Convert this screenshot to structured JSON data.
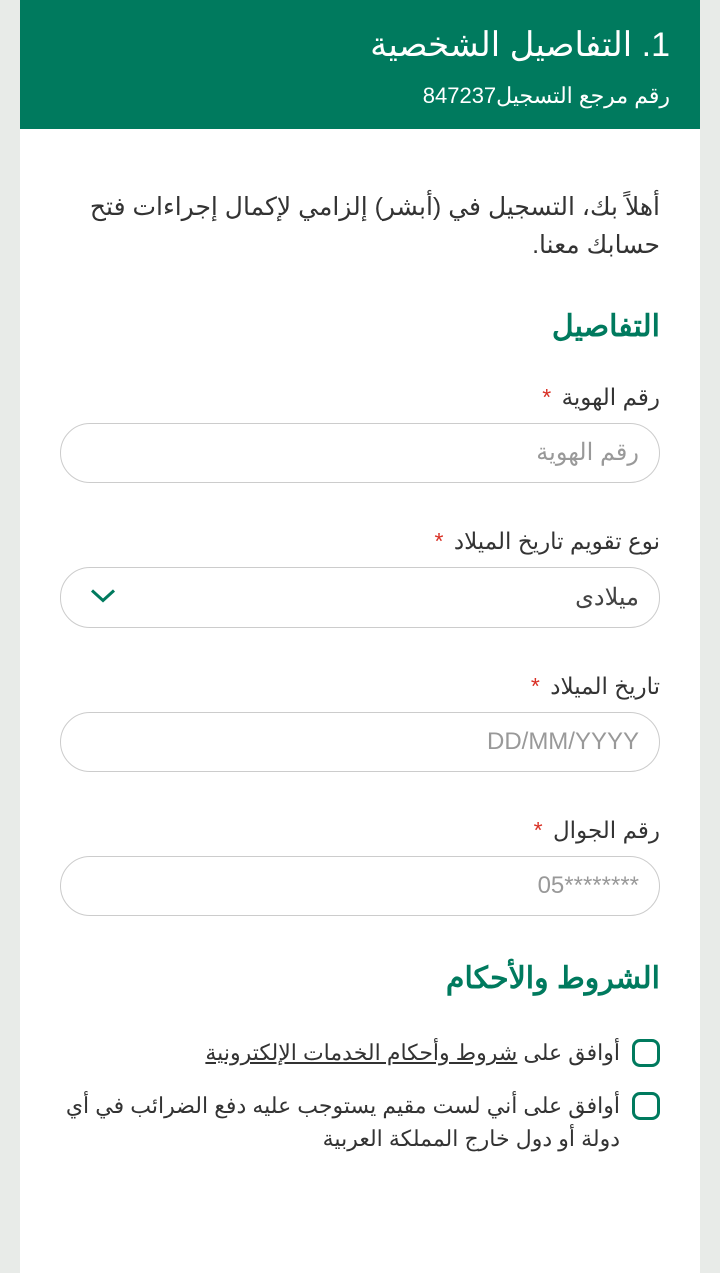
{
  "header": {
    "title": "1. التفاصيل الشخصية",
    "subtitle": "رقم مرجع التسجيل847237"
  },
  "intro": "أهلاً بك، التسجيل في (أبشر) إلزامي لإكمال إجراءات فتح حسابك معنا.",
  "details": {
    "section_title": "التفاصيل",
    "id_label": "رقم الهوية",
    "id_placeholder": "رقم الهوية",
    "calendar_label": "نوع تقويم تاريخ الميلاد",
    "calendar_value": "ميلادى",
    "dob_label": "تاريخ الميلاد",
    "dob_placeholder": "DD/MM/YYYY",
    "mobile_label": "رقم الجوال",
    "mobile_placeholder": "05********"
  },
  "terms": {
    "section_title": "الشروط والأحكام",
    "agree_prefix": "أوافق على ",
    "terms_link": "شروط وأحكام الخدمات الإلكترونية",
    "tax_text": "أوافق على أني لست مقيم يستوجب عليه دفع الضرائب في أي دولة أو دول خارج المملكة العربية"
  },
  "required_mark": "*"
}
